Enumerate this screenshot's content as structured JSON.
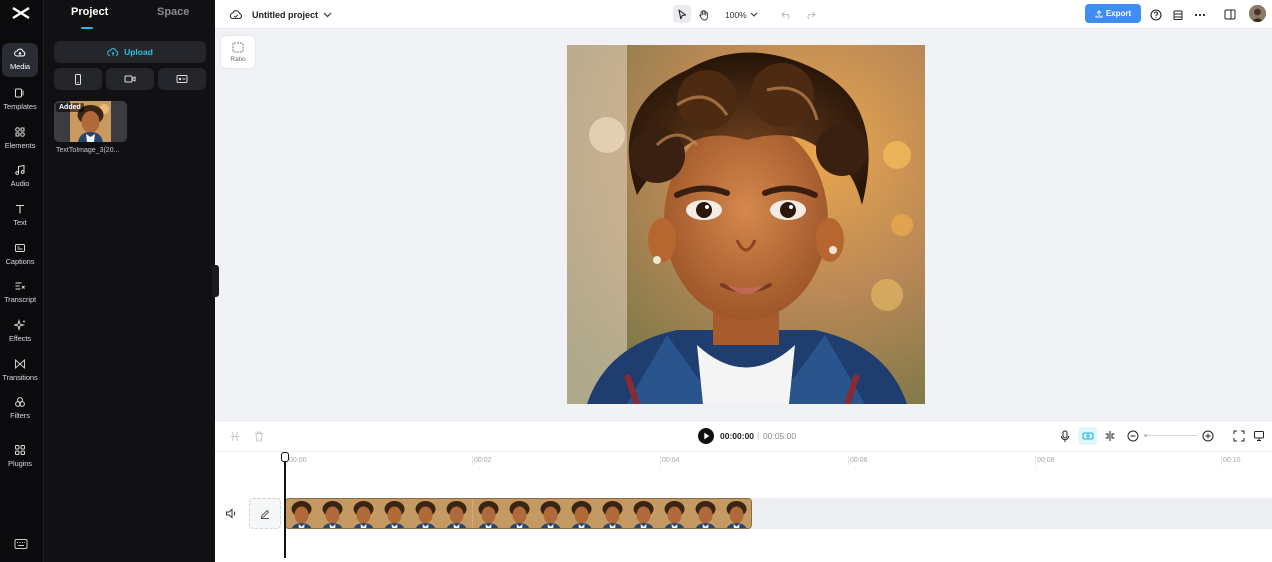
{
  "app": {
    "logo_icon": "capcut-logo-icon"
  },
  "rail": {
    "items": [
      {
        "label": "Media",
        "icon": "cloud-media-icon",
        "active": true
      },
      {
        "label": "Templates",
        "icon": "templates-icon"
      },
      {
        "label": "Elements",
        "icon": "elements-icon"
      },
      {
        "label": "Audio",
        "icon": "music-note-icon"
      },
      {
        "label": "Text",
        "icon": "text-t-icon"
      },
      {
        "label": "Captions",
        "icon": "captions-icon"
      },
      {
        "label": "Transcript",
        "icon": "transcript-icon"
      },
      {
        "label": "Effects",
        "icon": "sparkle-icon"
      },
      {
        "label": "Transitions",
        "icon": "transitions-icon"
      },
      {
        "label": "Filters",
        "icon": "filters-icon"
      },
      {
        "label": "Plugins",
        "icon": "plugins-grid-icon"
      }
    ]
  },
  "panel": {
    "tabs": [
      "Project",
      "Space"
    ],
    "upload_label": "Upload",
    "media": [
      {
        "badge": "Added",
        "name": "TextToImage_3(20..."
      }
    ]
  },
  "topbar": {
    "project_title": "Untitled project",
    "zoom": "100%",
    "export_label": "Export"
  },
  "canvas": {
    "ratio_label": "Ratio"
  },
  "timeline": {
    "current_time": "00:00:00",
    "separator": "|",
    "total_time": "00:05:00",
    "ticks": [
      "00:00",
      "00:02",
      "00:04",
      "00:06",
      "00:08",
      "00:10"
    ]
  },
  "colors": {
    "accent": "#2bc0e0",
    "export": "#3f8cf2",
    "rail_bg": "#0b0b0d",
    "panel_bg": "#111114"
  }
}
